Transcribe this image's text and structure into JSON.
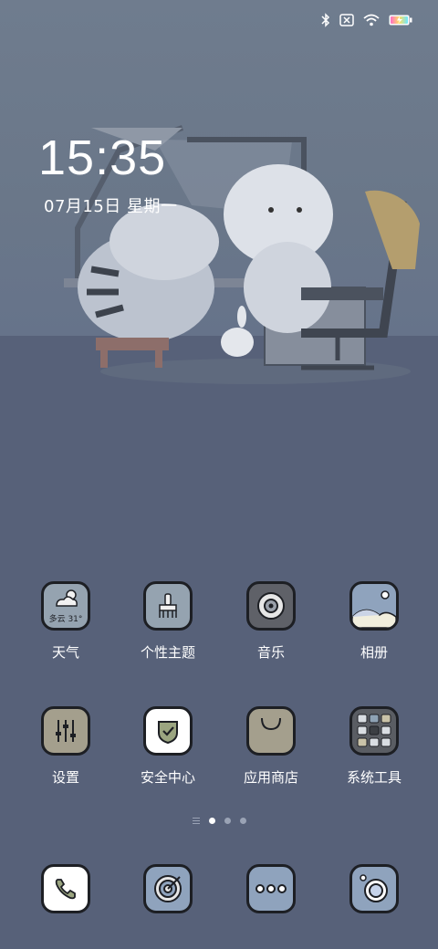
{
  "status_bar": {
    "icons": [
      "bluetooth-icon",
      "no-sim-icon",
      "wifi-icon",
      "battery-charging-icon"
    ]
  },
  "clock": {
    "time": "15:35",
    "date": "07月15日  星期一"
  },
  "apps": [
    {
      "label": "天气",
      "icon": "weather-icon",
      "weather_text": "多云 31°"
    },
    {
      "label": "个性主题",
      "icon": "theme-brush-icon"
    },
    {
      "label": "音乐",
      "icon": "music-disc-icon"
    },
    {
      "label": "相册",
      "icon": "gallery-icon"
    },
    {
      "label": "设置",
      "icon": "settings-sliders-icon"
    },
    {
      "label": "安全中心",
      "icon": "security-shield-icon"
    },
    {
      "label": "应用商店",
      "icon": "app-store-bag-icon"
    },
    {
      "label": "系统工具",
      "icon": "system-tools-folder-icon"
    }
  ],
  "pager": {
    "pages": 3,
    "current": 1
  },
  "dock": [
    {
      "icon": "phone-icon"
    },
    {
      "icon": "browser-target-icon"
    },
    {
      "icon": "messages-icon"
    },
    {
      "icon": "camera-icon"
    }
  ],
  "colors": {
    "wall": "#6f7c8e",
    "floor": "#576179",
    "tile_outline": "#1d1f24"
  }
}
